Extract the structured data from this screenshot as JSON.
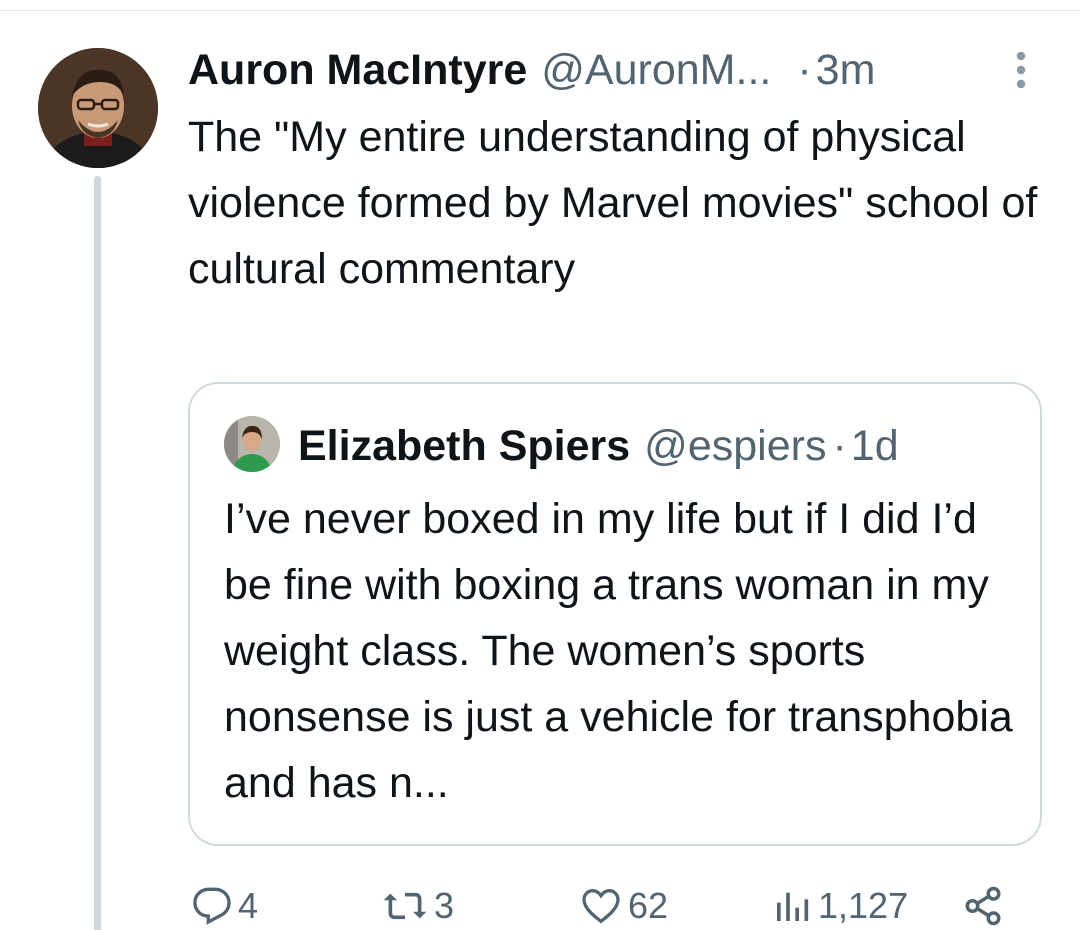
{
  "tweet": {
    "author": {
      "display_name": "Auron MacIntyre",
      "handle": "@AuronM...",
      "separator": "·",
      "time": "3m"
    },
    "text": "The \"My entire understanding of physical violence formed by Marvel movies\" school of cultural commentary",
    "quoted": {
      "display_name": "Elizabeth Spiers",
      "handle": "@espiers",
      "separator": "·",
      "time": "1d",
      "text": "I’ve never boxed in my life but if I did I’d be fine with boxing a trans woman in my weight class. The women’s sports nonsense is just a vehicle for transphobia and has n..."
    },
    "actions": {
      "replies": "4",
      "retweets": "3",
      "likes": "62",
      "views": "1,127"
    }
  },
  "icons": {
    "more": "more-vertical-icon",
    "reply": "reply-icon",
    "retweet": "retweet-icon",
    "like": "heart-icon",
    "views": "views-icon",
    "share": "share-icon"
  },
  "colors": {
    "text": "#0f1419",
    "secondary": "#536471",
    "border": "#cfd9de"
  }
}
